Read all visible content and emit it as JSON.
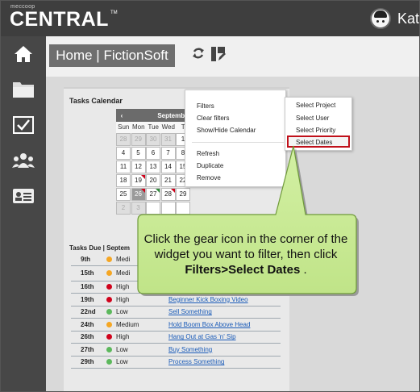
{
  "app": {
    "brand_small": "meccoop",
    "brand": "CENTRAL",
    "brand_tm": "TM",
    "user_name": "Kate"
  },
  "sidebar": {
    "items": [
      {
        "icon": "home-icon"
      },
      {
        "icon": "folder-icon"
      },
      {
        "icon": "checkbox-icon"
      },
      {
        "icon": "people-icon"
      },
      {
        "icon": "contact-card-icon"
      }
    ]
  },
  "breadcrumb": {
    "text": "Home | FictionSoft"
  },
  "toolbar": {
    "refresh_icon": "refresh-icon",
    "edit_icon": "edit-layout-icon"
  },
  "widget": {
    "title": "Tasks Calendar",
    "calendar": {
      "month_label": "September",
      "prev_icon": "‹",
      "dows": [
        "Sun",
        "Mon",
        "Tue",
        "Wed",
        "T"
      ],
      "weeks": [
        [
          "28",
          "29",
          "30",
          "31",
          "1"
        ],
        [
          "4",
          "5",
          "6",
          "7",
          "8"
        ],
        [
          "11",
          "12",
          "13",
          "14",
          "15"
        ],
        [
          "18",
          "19",
          "20",
          "21",
          "22"
        ],
        [
          "25",
          "26",
          "27",
          "28",
          "29"
        ],
        [
          "2",
          "3",
          "",
          "",
          ""
        ]
      ]
    },
    "tasks_header": "Tasks Due | Septem",
    "tasks": [
      {
        "date": "9th",
        "priority": "Medi",
        "name": "",
        "color": "#f5a623"
      },
      {
        "date": "15th",
        "priority": "Medi",
        "name": "",
        "color": "#f5a623"
      },
      {
        "date": "16th",
        "priority": "High",
        "name": "",
        "color": "#d0021b"
      },
      {
        "date": "19th",
        "priority": "High",
        "name": "Beginner Kick Boxing Video",
        "color": "#d0021b"
      },
      {
        "date": "22nd",
        "priority": "Low",
        "name": "Sell Something",
        "color": "#5cb85c"
      },
      {
        "date": "24th",
        "priority": "Medium",
        "name": "Hold Boom Box Above Head",
        "color": "#f5a623"
      },
      {
        "date": "26th",
        "priority": "High",
        "name": "Hang Out at Gas 'n' Sip",
        "color": "#d0021b"
      },
      {
        "date": "27th",
        "priority": "Low",
        "name": "Buy Something",
        "color": "#5cb85c"
      },
      {
        "date": "29th",
        "priority": "Low",
        "name": "Process Something",
        "color": "#5cb85c"
      }
    ]
  },
  "gear_menu": {
    "items": [
      "Filters",
      "Clear filters",
      "Show/Hide Calendar",
      "Refresh",
      "Duplicate",
      "Remove"
    ]
  },
  "filters_menu": {
    "items": [
      "Select Project",
      "Select User",
      "Select Priority",
      "Select Dates"
    ]
  },
  "callout": {
    "text_pre": "Click the gear icon in the corner of the widget you want to filter, then click ",
    "text_bold": "Filters>Select Dates",
    "text_post": " ."
  }
}
